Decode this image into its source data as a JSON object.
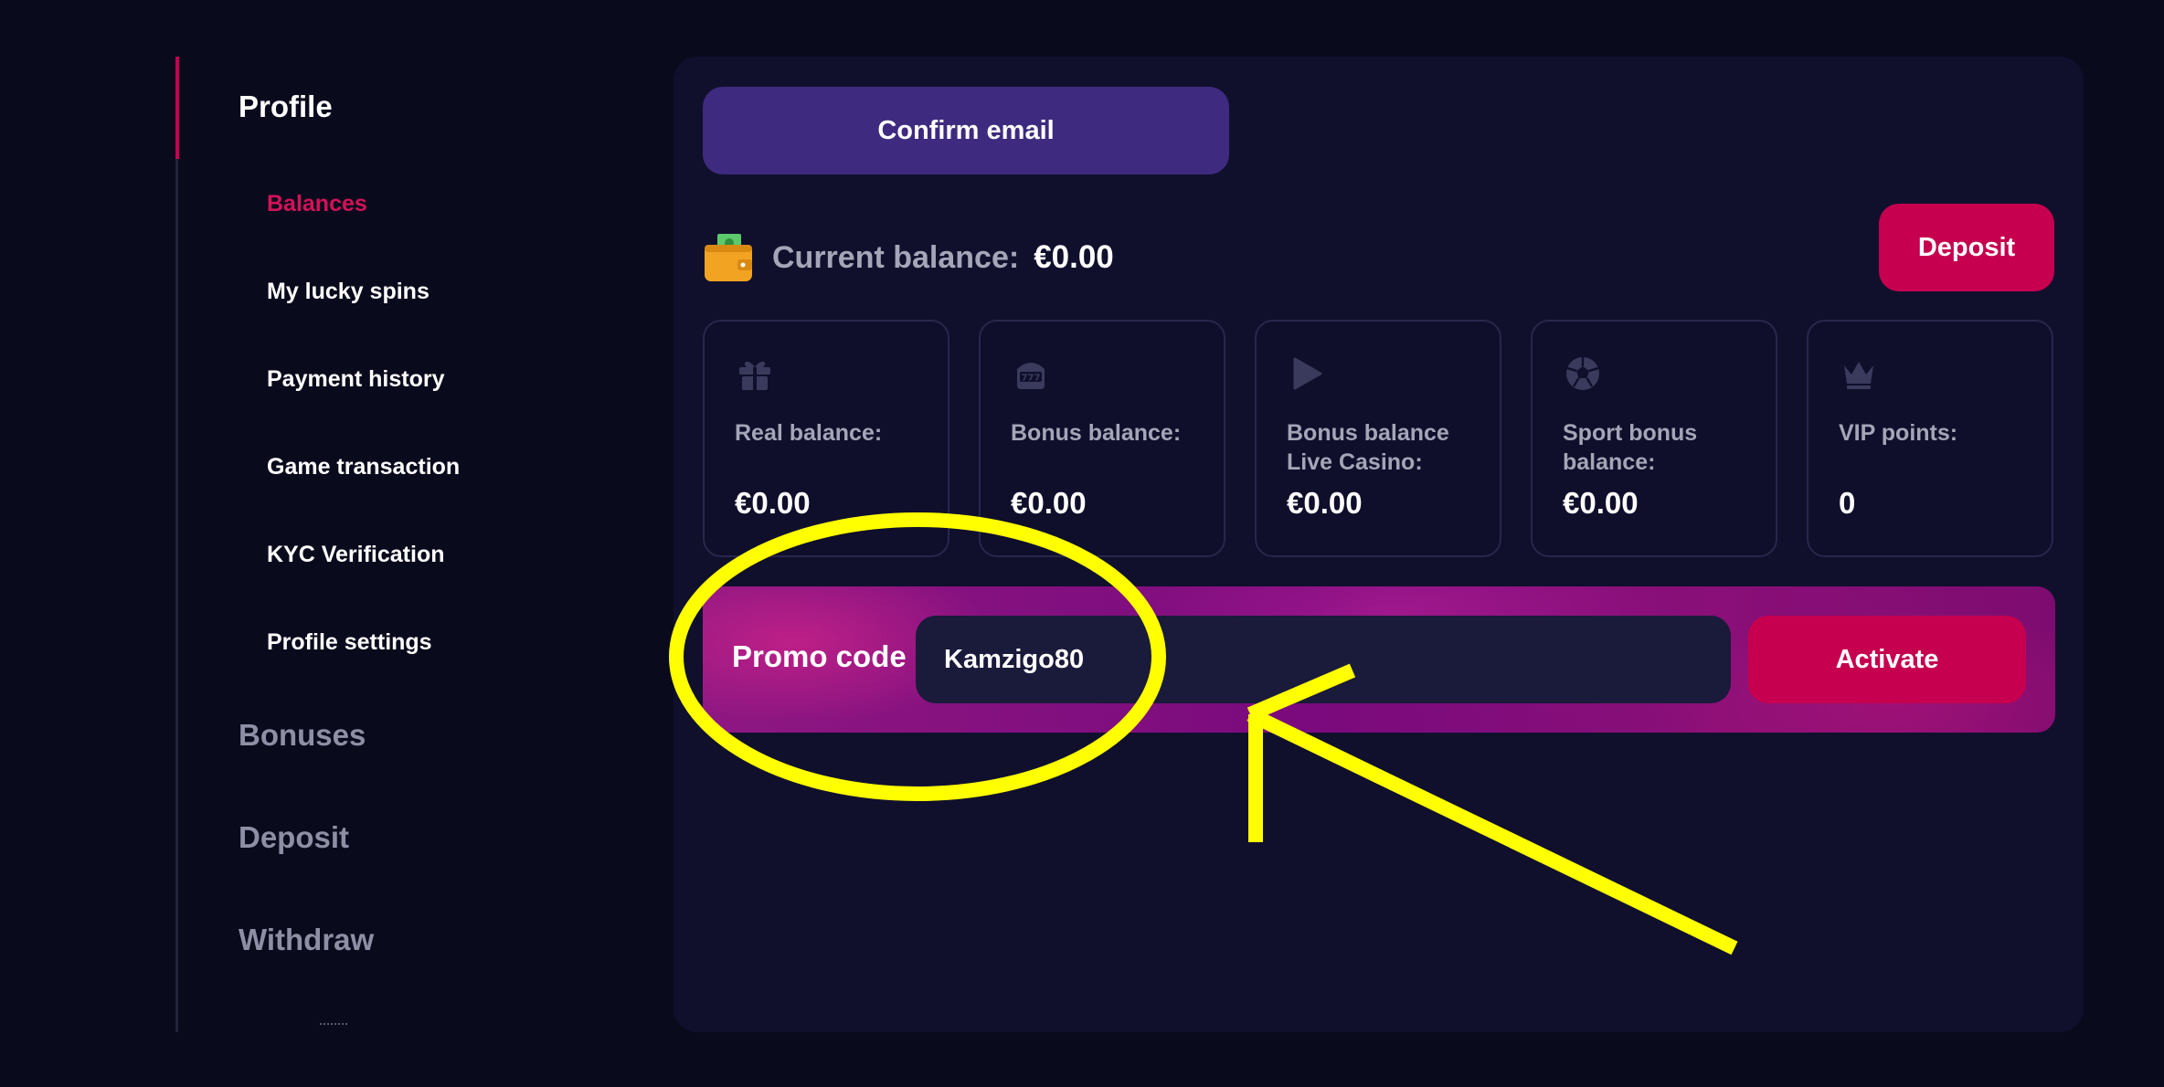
{
  "sidebar": {
    "profile_label": "Profile",
    "items": [
      {
        "label": "Balances",
        "active": true
      },
      {
        "label": "My lucky spins"
      },
      {
        "label": "Payment history"
      },
      {
        "label": "Game transaction"
      },
      {
        "label": "KYC Verification"
      },
      {
        "label": "Profile settings"
      }
    ],
    "sections": [
      {
        "label": "Bonuses"
      },
      {
        "label": "Deposit"
      },
      {
        "label": "Withdraw"
      }
    ]
  },
  "main": {
    "confirm_email_label": "Confirm email",
    "current_balance_label": "Current balance:",
    "current_balance_value": "€0.00",
    "deposit_label": "Deposit",
    "cards": [
      {
        "icon": "gift-icon",
        "label": "Real balance:",
        "value": "€0.00"
      },
      {
        "icon": "slot-machine-icon",
        "label": "Bonus balance:",
        "value": "€0.00"
      },
      {
        "icon": "play-icon",
        "label": "Bonus balance Live Casino:",
        "value": "€0.00"
      },
      {
        "icon": "soccer-ball-icon",
        "label": "Sport bonus balance:",
        "value": "€0.00"
      },
      {
        "icon": "crown-icon",
        "label": "VIP points:",
        "value": "0"
      }
    ],
    "promo": {
      "label": "Promo code",
      "value": "Kamzigo80",
      "activate_label": "Activate"
    }
  },
  "colors": {
    "accent": "#c6004f",
    "confirm": "#3e2a7e",
    "annotation": "#ffff00"
  }
}
